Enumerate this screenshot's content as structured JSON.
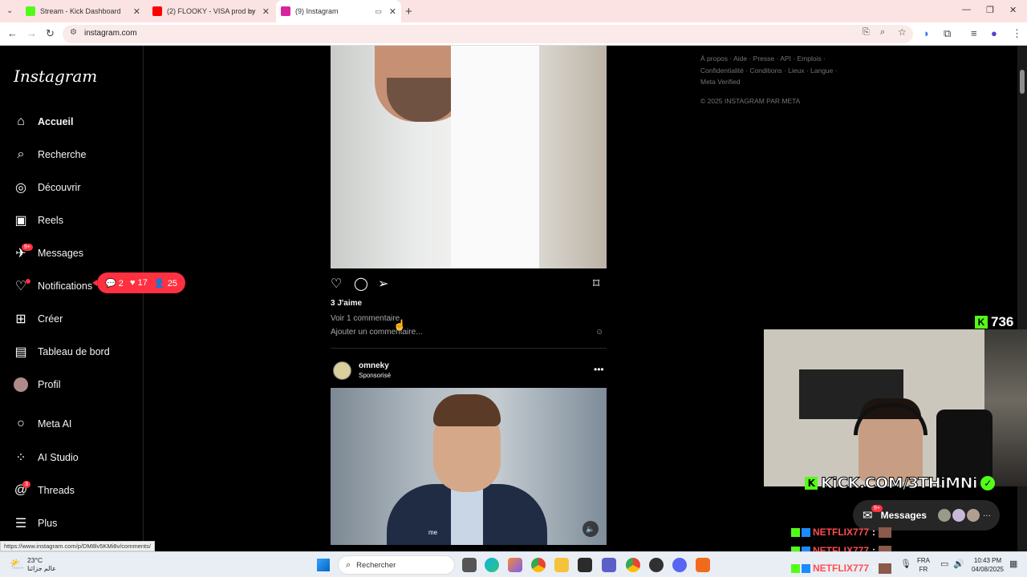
{
  "browser": {
    "tabs": [
      {
        "title": "Stream - Kick Dashboard",
        "color": "#53fc18"
      },
      {
        "title": "(2) FLOOKY - VISA prod by",
        "color": "#ff0000"
      },
      {
        "title": "(9) Instagram",
        "color": "#d6249f"
      }
    ],
    "url": "instagram.com",
    "status_url": "https://www.instagram.com/p/DM8lv5KMi8v/comments/"
  },
  "instagram": {
    "logo": "Instagram",
    "nav": [
      {
        "label": "Accueil",
        "icon": "home-icon"
      },
      {
        "label": "Recherche",
        "icon": "search-icon"
      },
      {
        "label": "Découvrir",
        "icon": "compass-icon"
      },
      {
        "label": "Reels",
        "icon": "reels-icon"
      },
      {
        "label": "Messages",
        "icon": "messenger-icon",
        "badge": "9+"
      },
      {
        "label": "Notifications",
        "icon": "heart-icon"
      },
      {
        "label": "Créer",
        "icon": "plus-square-icon"
      },
      {
        "label": "Tableau de bord",
        "icon": "chart-icon"
      },
      {
        "label": "Profil",
        "icon": "avatar-icon"
      },
      {
        "label": "Meta AI",
        "icon": "meta-ai-icon"
      },
      {
        "label": "AI Studio",
        "icon": "ai-studio-icon"
      },
      {
        "label": "Threads",
        "icon": "threads-icon",
        "badge": "3"
      },
      {
        "label": "Plus",
        "icon": "menu-icon"
      }
    ],
    "notif_popup": {
      "comments": "2",
      "likes": "17",
      "follows": "25"
    },
    "post1": {
      "likes": "3 J'aime",
      "view_comments": "Voir 1 commentaire",
      "add_comment_placeholder": "Ajouter un commentaire..."
    },
    "post2": {
      "username": "omneky",
      "sponsored": "Sponsorisé",
      "caption_overlay": "me"
    },
    "footer": {
      "links": "À propos · Aide · Presse · API · Emplois · Confidentialité · Conditions · Lieux · Langue · Meta Verified",
      "copyright": "© 2025 INSTAGRAM PAR META"
    }
  },
  "stream_overlay": {
    "viewer_count": "736",
    "kick_url": "KiCK.COM/3THiMNi",
    "messages_label": "Messages",
    "messages_badge": "9+",
    "chat": [
      {
        "name": "NETFLIX777"
      },
      {
        "name": "NETFLIX777"
      },
      {
        "name": "NETFLIX777"
      }
    ]
  },
  "taskbar": {
    "weather_temp": "23°C",
    "weather_desc": "عالم جزائنا",
    "search_placeholder": "Rechercher",
    "lang_top": "FRA",
    "lang_bottom": "FR",
    "time": "10:43 PM",
    "date": "04/08/2025"
  }
}
